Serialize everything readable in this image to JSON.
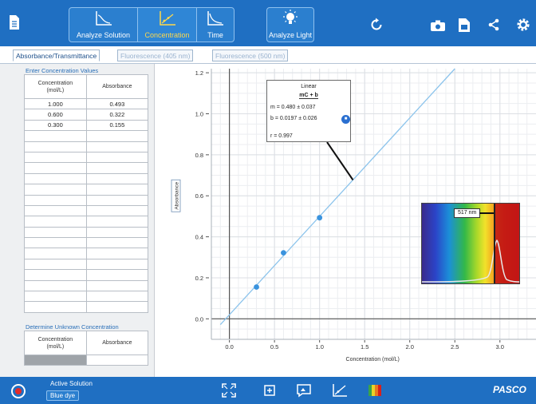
{
  "toolbar": {
    "modes": [
      {
        "label": "Analyze Solution",
        "icon": "analyze-solution-icon",
        "active": false
      },
      {
        "label": "Concentration",
        "icon": "concentration-icon",
        "active": true
      },
      {
        "label": "Time",
        "icon": "time-icon",
        "active": false
      }
    ],
    "analyze_light": {
      "label": "Analyze Light",
      "icon": "light-bulb-icon"
    },
    "icons": [
      "document-icon",
      "refresh-icon",
      "camera-icon",
      "save-file-icon",
      "share-icon",
      "gear-icon"
    ]
  },
  "tabs": [
    {
      "label": "Absorbance/Transmittance",
      "active": true
    },
    {
      "label": "Fluorescence (405 nm)",
      "active": false
    },
    {
      "label": "Fluorescence (500 nm)",
      "active": false
    }
  ],
  "concentration_table": {
    "title": "Enter Concentration Values",
    "headers": [
      "Concentration (mol/L)",
      "Absorbance"
    ],
    "rows": [
      [
        "1.000",
        "0.493"
      ],
      [
        "0.600",
        "0.322"
      ],
      [
        "0.300",
        "0.155"
      ]
    ]
  },
  "unknown_table": {
    "title": "Determine Unknown Concentration",
    "headers": [
      "Concentration (mol/L)",
      "Absorbance"
    ]
  },
  "fit": {
    "type": "Linear",
    "equation": "mC + b",
    "m": "m = 0.480 ± 0.037",
    "b": "b = 0.0197 ± 0.026",
    "r": "r = 0.997"
  },
  "spectrum": {
    "wavelength_label": "517 nm"
  },
  "status": {
    "active_solution_label": "Active Solution",
    "solution": "Blue dye",
    "brand": "PASCO"
  },
  "bottom_icons": [
    "fullscreen-icon",
    "fit-icon",
    "annotation-icon",
    "graph-icon",
    "spectrum-icon"
  ],
  "chart_data": {
    "type": "scatter",
    "xlabel": "Concentration (mol/L)",
    "ylabel": "Absorbance",
    "xlim": [
      -0.2,
      3.4
    ],
    "ylim": [
      -0.1,
      1.22
    ],
    "xticks": [
      0.0,
      0.5,
      1.0,
      1.5,
      2.0,
      2.5,
      3.0
    ],
    "yticks": [
      0.0,
      0.2,
      0.4,
      0.6,
      0.8,
      1.0,
      1.2
    ],
    "xtick_labels": [
      "0.0",
      "0.5",
      "1.0",
      "1.5",
      "2.0",
      "2.5",
      "3.0"
    ],
    "ytick_labels": [
      "0.0",
      "0.2",
      "0.4",
      "0.6",
      "0.8",
      "1.0",
      "1.2"
    ],
    "points": [
      {
        "x": 0.3,
        "y": 0.155
      },
      {
        "x": 0.6,
        "y": 0.322
      },
      {
        "x": 1.0,
        "y": 0.493
      }
    ],
    "fit_line": {
      "m": 0.48,
      "b": 0.0197
    },
    "grid": true,
    "point_color": "#3a93de",
    "line_color": "#8cc4ec"
  }
}
